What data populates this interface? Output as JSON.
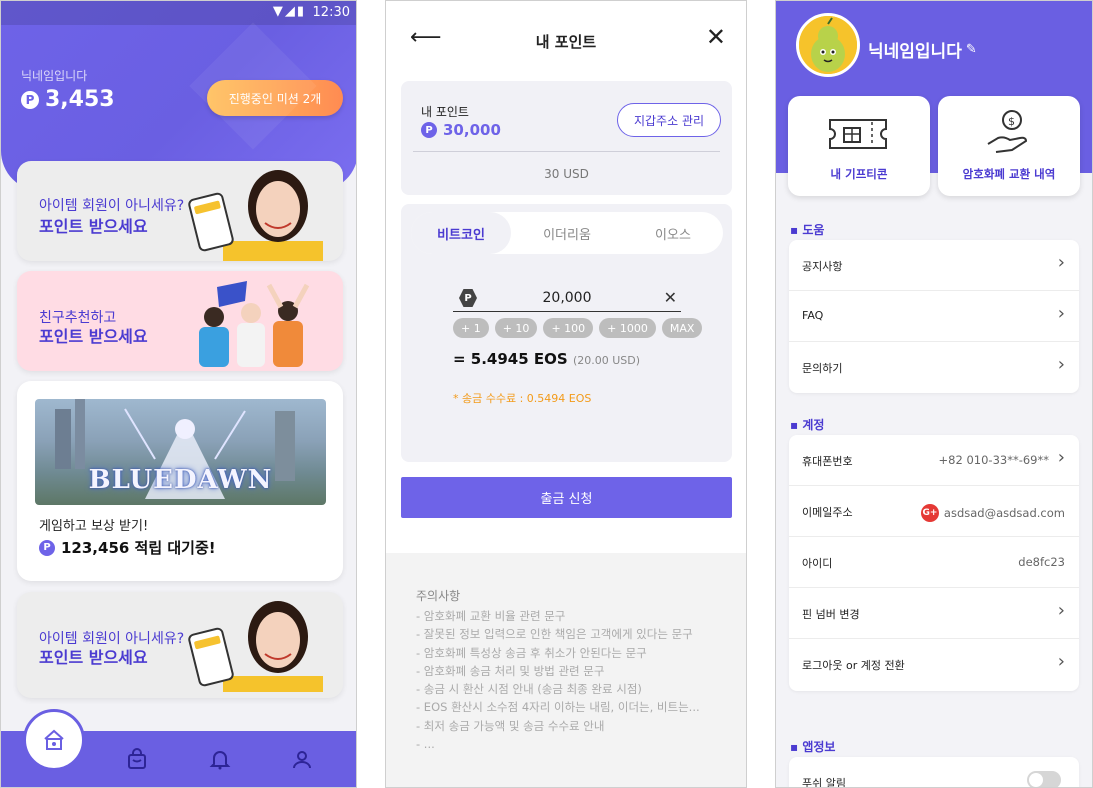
{
  "home": {
    "status_time": "12:30",
    "nickname": "닉네임입니다",
    "points_badge": "P",
    "points": "3,453",
    "mission_button": "진행중인 미션 2개",
    "cards": [
      {
        "line1": "아이템 회원이 아니세유?",
        "line2": "포인트 받으세요"
      },
      {
        "line1": "친구추천하고",
        "line2": "포인트 받으세요"
      },
      {
        "line1": "아이템 회원이 아니세유?",
        "line2": "포인트 받으세요"
      }
    ],
    "game_banner": {
      "logo": "BLUEDAWN",
      "reward_text": "게임하고 보상 받기!",
      "wait_text": "123,456 적립 대기중!"
    },
    "tabbar": [
      "home-icon",
      "bag-icon",
      "bell-icon",
      "user-icon"
    ]
  },
  "points_page": {
    "title": "내 포인트",
    "my_points_label": "내 포인트",
    "my_points_value": "30,000",
    "wallet_button": "지갑주소 관리",
    "usd_value": "30 USD",
    "coin_tabs": [
      "비트코인",
      "이더리움",
      "이오스"
    ],
    "active_tab": 0,
    "amount_input": "20,000",
    "chips": [
      "+ 1",
      "+ 10",
      "+ 100",
      "+ 1000",
      "MAX"
    ],
    "converted": "= 5.4945 EOS",
    "converted_usd": "(20.00 USD)",
    "fee": "* 송금 수수료 : 0.5494 EOS",
    "withdraw_button": "출금 신청",
    "notice_title": "주의사항",
    "notice_items": [
      "- 암호화폐 교환 비율 관련 문구",
      "- 잘못된 정보 입력으로 인한 책임은 고객에게 있다는 문구",
      "- 암호화폐 특성상 송금 후 취소가 안된다는 문구",
      "- 암호화폐 송금 처리 및 방법 관련 문구",
      "- 송금 시 환산 시점 안내 (송금 최종 완료 시점)",
      "- EOS 환산시 소수점 4자리 이하는 내림, 이더는, 비트는...",
      "- 최저 송금 가능액 및 송금 수수료 안내",
      "- ..."
    ]
  },
  "profile": {
    "nickname": "닉네임입니다",
    "feature_cards": [
      "내 기프티콘",
      "암호화폐 교환 내역"
    ],
    "sections": {
      "help": {
        "title": "도움",
        "rows": [
          "공지사항",
          "FAQ",
          "문의하기"
        ]
      },
      "account": {
        "title": "계정",
        "rows": [
          {
            "label": "휴대폰번호",
            "value": "+82 010-33**-69**"
          },
          {
            "label": "이메일주소",
            "value": "asdsad@asdsad.com"
          },
          {
            "label": "아이디",
            "value": "de8fc23"
          },
          {
            "label": "핀 넘버 변경",
            "value": ""
          },
          {
            "label": "로그아웃 or 계정 전환",
            "value": ""
          }
        ]
      },
      "app": {
        "title": "앱정보",
        "rows": [
          "푸쉬 알림"
        ]
      }
    },
    "google_badge": "G+"
  }
}
